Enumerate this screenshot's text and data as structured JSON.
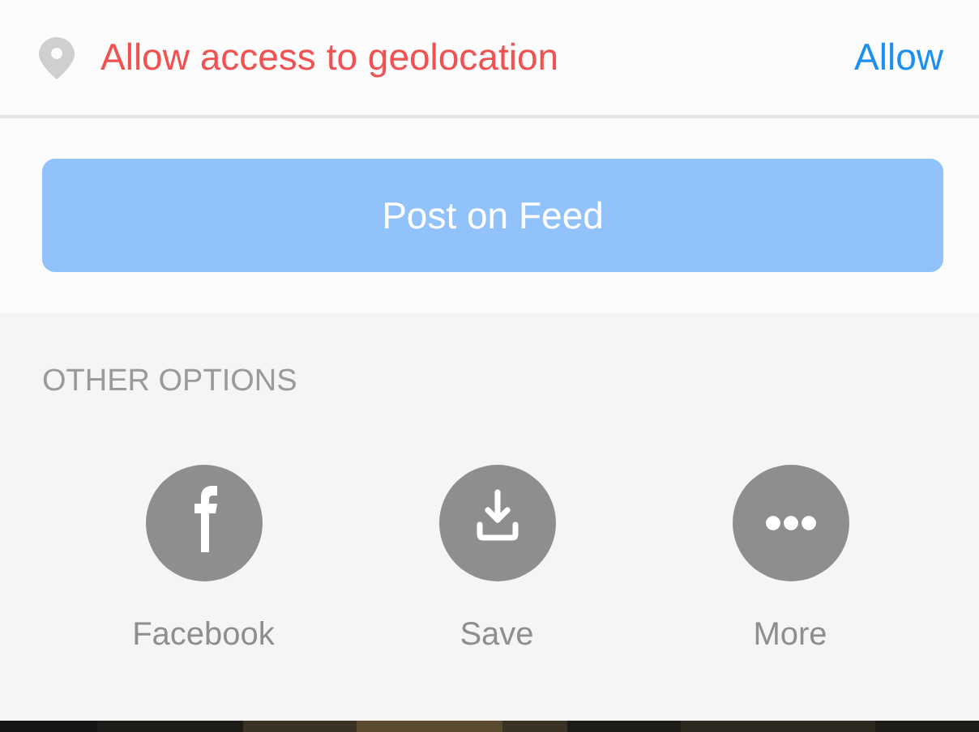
{
  "location_prompt": {
    "message": "Allow access to geolocation",
    "action": "Allow"
  },
  "post_button": {
    "label": "Post on Feed",
    "disabled": true
  },
  "other_options": {
    "heading": "OTHER OPTIONS",
    "items": [
      {
        "kind": "facebook",
        "label": "Facebook"
      },
      {
        "kind": "save",
        "label": "Save"
      },
      {
        "kind": "more",
        "label": "More"
      }
    ]
  }
}
